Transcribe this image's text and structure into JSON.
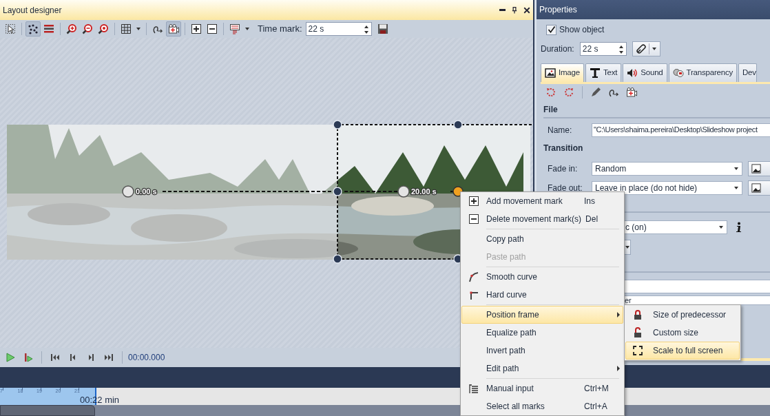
{
  "layout_designer": {
    "title": "Layout designer",
    "tool_groups": [
      [
        {
          "kind": "pointer",
          "selected": false
        }
      ],
      [
        {
          "kind": "points",
          "selected": true
        },
        {
          "kind": "lines",
          "selected": false
        }
      ],
      [
        {
          "kind": "zoom-in",
          "selected": false
        },
        {
          "kind": "zoom-out",
          "selected": false
        },
        {
          "kind": "zoom-fit",
          "selected": false
        }
      ],
      [
        {
          "kind": "grid",
          "selected": false
        }
      ],
      [
        {
          "kind": "path",
          "selected": false
        },
        {
          "kind": "camera",
          "selected": true
        }
      ],
      [
        {
          "kind": "add",
          "selected": false
        },
        {
          "kind": "remove",
          "selected": false
        }
      ],
      [
        {
          "kind": "align",
          "selected": false
        }
      ]
    ],
    "time_mark": {
      "label": "Time mark:",
      "value": "22 s"
    },
    "marks": [
      {
        "label": "0.00 s"
      },
      {
        "label": "20.00 s"
      }
    ],
    "playback_time": "00:00.000"
  },
  "properties": {
    "title": "Properties",
    "show_object": {
      "label": "Show object",
      "checked": true
    },
    "duration": {
      "label": "Duration:",
      "value": "22 s"
    },
    "tabs": [
      {
        "label": "Image",
        "selected": true
      },
      {
        "label": "Text",
        "selected": false
      },
      {
        "label": "Sound",
        "selected": false
      },
      {
        "label": "Transparency",
        "selected": false
      },
      {
        "label": "Dev",
        "selected": false
      }
    ],
    "file": {
      "heading": "File",
      "name_label": "Name:",
      "name_value": "\"C:\\Users\\shaima.pereira\\Desktop\\Slideshow project"
    },
    "transition": {
      "heading": "Transition",
      "fade_in_label": "Fade in:",
      "fade_in": "Random",
      "fade_out_label": "Fade out:",
      "fade_out": "Leave in place (do not hide)"
    },
    "partial_dropdown": "c (on)",
    "partial_field": "er"
  },
  "timeline": {
    "ticks": [
      "7",
      "18",
      "19",
      "20",
      "21"
    ],
    "position": "00:22 min"
  },
  "context_menu": {
    "groups": [
      [
        {
          "kind": "add",
          "label": "Add movement mark",
          "shortcut": "Ins",
          "disabled": false,
          "selected": false,
          "submenu": false
        },
        {
          "kind": "delete",
          "label": "Delete movement mark(s)",
          "shortcut": "Del",
          "disabled": false,
          "selected": false,
          "submenu": false
        }
      ],
      [
        {
          "kind": "plain",
          "label": "Copy path",
          "disabled": false,
          "selected": false,
          "submenu": false
        },
        {
          "kind": "plain",
          "label": "Paste path",
          "disabled": true,
          "selected": false,
          "submenu": false
        }
      ],
      [
        {
          "kind": "smooth",
          "label": "Smooth curve",
          "disabled": false,
          "selected": false,
          "submenu": false
        },
        {
          "kind": "hard",
          "label": "Hard curve",
          "disabled": false,
          "selected": false,
          "submenu": false
        }
      ],
      [
        {
          "kind": "plain",
          "label": "Position frame",
          "disabled": false,
          "selected": true,
          "submenu": true
        },
        {
          "kind": "plain",
          "label": "Equalize path",
          "disabled": false,
          "selected": false,
          "submenu": false
        },
        {
          "kind": "plain",
          "label": "Invert path",
          "disabled": false,
          "selected": false,
          "submenu": false
        },
        {
          "kind": "plain",
          "label": "Edit path",
          "disabled": false,
          "selected": false,
          "submenu": true
        }
      ],
      [
        {
          "kind": "manual",
          "label": "Manual input",
          "shortcut": "Ctrl+M",
          "disabled": false,
          "selected": false,
          "submenu": false
        },
        {
          "kind": "plain",
          "label": "Select all marks",
          "shortcut": "Ctrl+A",
          "disabled": false,
          "selected": false,
          "submenu": false
        }
      ]
    ],
    "submenu": [
      {
        "kind": "lock",
        "label": "Size of predecessor",
        "selected": false
      },
      {
        "kind": "unlock",
        "label": "Custom size",
        "selected": false
      },
      {
        "kind": "fullscreen",
        "label": "Scale to full screen",
        "selected": true
      }
    ]
  }
}
